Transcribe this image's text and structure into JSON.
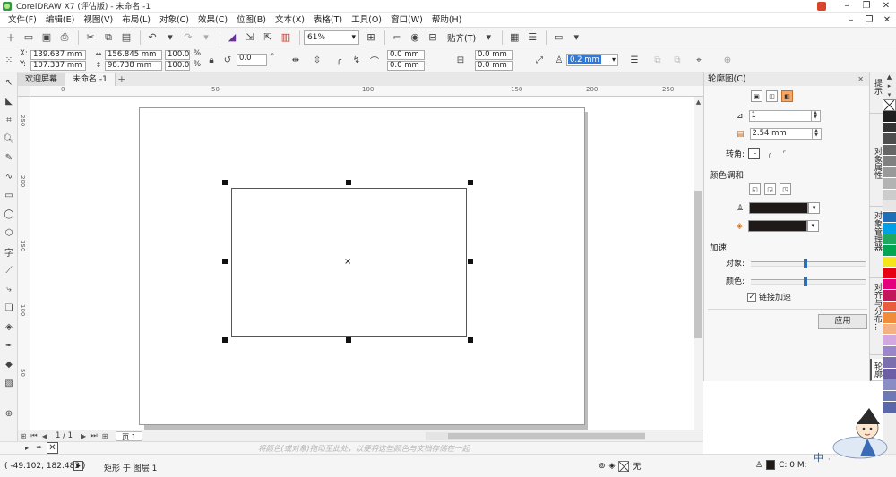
{
  "window": {
    "title": "CorelDRAW X7 (评估版) - 未命名 -1",
    "controls": [
      "–",
      "❐",
      "✕"
    ]
  },
  "menu": {
    "items": [
      "文件(F)",
      "编辑(E)",
      "视图(V)",
      "布局(L)",
      "对象(C)",
      "效果(C)",
      "位图(B)",
      "文本(X)",
      "表格(T)",
      "工具(O)",
      "窗口(W)",
      "帮助(H)"
    ]
  },
  "toolbar": {
    "zoom": "61%",
    "snap_label": "贴齐(T)"
  },
  "propbar": {
    "x": "139.637 mm",
    "y": "107.337 mm",
    "width": "156.845 mm",
    "height": "98.738 mm",
    "scale_x": "100.0",
    "scale_y": "100.0",
    "percent": "%",
    "rotation": "0.0",
    "degree": "°",
    "corner_1": "0.0 mm",
    "corner_2": "0.0 mm",
    "corner_3": "0.0 mm",
    "corner_4": "0.0 mm",
    "outline_width": "0.2 mm",
    "x_label": "X:",
    "y_label": "Y:"
  },
  "tabs": [
    {
      "label": "欢迎屏幕",
      "active": false
    },
    {
      "label": "未命名 -1",
      "active": true
    }
  ],
  "ruler": {
    "top_labels": [
      "0",
      "50",
      "100",
      "150",
      "200",
      "250"
    ],
    "left_labels": [
      "250",
      "200",
      "150",
      "100",
      "50"
    ]
  },
  "page_nav": {
    "count": "1 / 1",
    "page_tab": "页 1"
  },
  "color_hint": "将颜色(或对象)拖动至此处，以便将这些颜色与文档存储在一起",
  "status": {
    "coords": "( -49.102, 182.483 )",
    "info": "矩形 于 图层 1",
    "fill_label": "无",
    "outline_label": "C: 0 M:"
  },
  "docker": {
    "title": "轮廓图(C)",
    "steps": "1",
    "offset": "2.54 mm",
    "corner_label": "转角:",
    "color_blend_label": "颜色调和",
    "outline_color": "#1f1a17",
    "fill_color": "#1f1a17",
    "accel_label": "加速",
    "object_label": "对象:",
    "color_label": "颜色:",
    "link_accel_label": "链接加速",
    "link_accel_checked": "✓",
    "apply_label": "应用",
    "object_accel": 0.46,
    "color_accel": 0.46
  },
  "vertical_tabs": [
    "提示",
    "对象属性",
    "对象管理器",
    "对齐与分布...",
    "轮廓图"
  ],
  "palette_colors": [
    "#1e1e1e",
    "#333333",
    "#4d4d4d",
    "#666666",
    "#808080",
    "#999999",
    "#b3b3b3",
    "#cccccc",
    "#e6e6e6",
    "#1f6fb8",
    "#00a0e9",
    "#20a85f",
    "#00a651",
    "#f5e61c",
    "#e60012",
    "#e4007f",
    "#c2185b",
    "#e95d3e",
    "#f08c3a",
    "#f4b183",
    "#d3a7e0",
    "#9b86c9",
    "#7b6fb0",
    "#6d5fa6",
    "#8b8ec4",
    "#6d7ab5",
    "#5a67a8"
  ]
}
